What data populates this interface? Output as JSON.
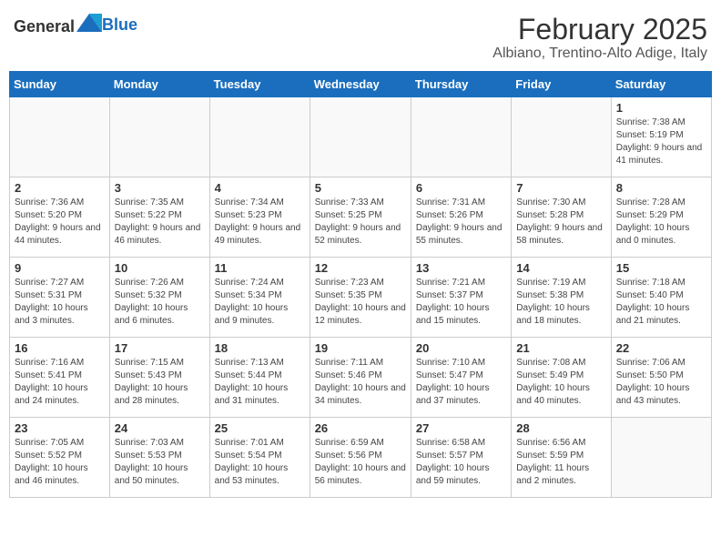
{
  "header": {
    "logo_general": "General",
    "logo_blue": "Blue",
    "title": "February 2025",
    "subtitle": "Albiano, Trentino-Alto Adige, Italy"
  },
  "weekdays": [
    "Sunday",
    "Monday",
    "Tuesday",
    "Wednesday",
    "Thursday",
    "Friday",
    "Saturday"
  ],
  "weeks": [
    [
      {
        "day": "",
        "info": ""
      },
      {
        "day": "",
        "info": ""
      },
      {
        "day": "",
        "info": ""
      },
      {
        "day": "",
        "info": ""
      },
      {
        "day": "",
        "info": ""
      },
      {
        "day": "",
        "info": ""
      },
      {
        "day": "1",
        "info": "Sunrise: 7:38 AM\nSunset: 5:19 PM\nDaylight: 9 hours and 41 minutes."
      }
    ],
    [
      {
        "day": "2",
        "info": "Sunrise: 7:36 AM\nSunset: 5:20 PM\nDaylight: 9 hours and 44 minutes."
      },
      {
        "day": "3",
        "info": "Sunrise: 7:35 AM\nSunset: 5:22 PM\nDaylight: 9 hours and 46 minutes."
      },
      {
        "day": "4",
        "info": "Sunrise: 7:34 AM\nSunset: 5:23 PM\nDaylight: 9 hours and 49 minutes."
      },
      {
        "day": "5",
        "info": "Sunrise: 7:33 AM\nSunset: 5:25 PM\nDaylight: 9 hours and 52 minutes."
      },
      {
        "day": "6",
        "info": "Sunrise: 7:31 AM\nSunset: 5:26 PM\nDaylight: 9 hours and 55 minutes."
      },
      {
        "day": "7",
        "info": "Sunrise: 7:30 AM\nSunset: 5:28 PM\nDaylight: 9 hours and 58 minutes."
      },
      {
        "day": "8",
        "info": "Sunrise: 7:28 AM\nSunset: 5:29 PM\nDaylight: 10 hours and 0 minutes."
      }
    ],
    [
      {
        "day": "9",
        "info": "Sunrise: 7:27 AM\nSunset: 5:31 PM\nDaylight: 10 hours and 3 minutes."
      },
      {
        "day": "10",
        "info": "Sunrise: 7:26 AM\nSunset: 5:32 PM\nDaylight: 10 hours and 6 minutes."
      },
      {
        "day": "11",
        "info": "Sunrise: 7:24 AM\nSunset: 5:34 PM\nDaylight: 10 hours and 9 minutes."
      },
      {
        "day": "12",
        "info": "Sunrise: 7:23 AM\nSunset: 5:35 PM\nDaylight: 10 hours and 12 minutes."
      },
      {
        "day": "13",
        "info": "Sunrise: 7:21 AM\nSunset: 5:37 PM\nDaylight: 10 hours and 15 minutes."
      },
      {
        "day": "14",
        "info": "Sunrise: 7:19 AM\nSunset: 5:38 PM\nDaylight: 10 hours and 18 minutes."
      },
      {
        "day": "15",
        "info": "Sunrise: 7:18 AM\nSunset: 5:40 PM\nDaylight: 10 hours and 21 minutes."
      }
    ],
    [
      {
        "day": "16",
        "info": "Sunrise: 7:16 AM\nSunset: 5:41 PM\nDaylight: 10 hours and 24 minutes."
      },
      {
        "day": "17",
        "info": "Sunrise: 7:15 AM\nSunset: 5:43 PM\nDaylight: 10 hours and 28 minutes."
      },
      {
        "day": "18",
        "info": "Sunrise: 7:13 AM\nSunset: 5:44 PM\nDaylight: 10 hours and 31 minutes."
      },
      {
        "day": "19",
        "info": "Sunrise: 7:11 AM\nSunset: 5:46 PM\nDaylight: 10 hours and 34 minutes."
      },
      {
        "day": "20",
        "info": "Sunrise: 7:10 AM\nSunset: 5:47 PM\nDaylight: 10 hours and 37 minutes."
      },
      {
        "day": "21",
        "info": "Sunrise: 7:08 AM\nSunset: 5:49 PM\nDaylight: 10 hours and 40 minutes."
      },
      {
        "day": "22",
        "info": "Sunrise: 7:06 AM\nSunset: 5:50 PM\nDaylight: 10 hours and 43 minutes."
      }
    ],
    [
      {
        "day": "23",
        "info": "Sunrise: 7:05 AM\nSunset: 5:52 PM\nDaylight: 10 hours and 46 minutes."
      },
      {
        "day": "24",
        "info": "Sunrise: 7:03 AM\nSunset: 5:53 PM\nDaylight: 10 hours and 50 minutes."
      },
      {
        "day": "25",
        "info": "Sunrise: 7:01 AM\nSunset: 5:54 PM\nDaylight: 10 hours and 53 minutes."
      },
      {
        "day": "26",
        "info": "Sunrise: 6:59 AM\nSunset: 5:56 PM\nDaylight: 10 hours and 56 minutes."
      },
      {
        "day": "27",
        "info": "Sunrise: 6:58 AM\nSunset: 5:57 PM\nDaylight: 10 hours and 59 minutes."
      },
      {
        "day": "28",
        "info": "Sunrise: 6:56 AM\nSunset: 5:59 PM\nDaylight: 11 hours and 2 minutes."
      },
      {
        "day": "",
        "info": ""
      }
    ]
  ]
}
